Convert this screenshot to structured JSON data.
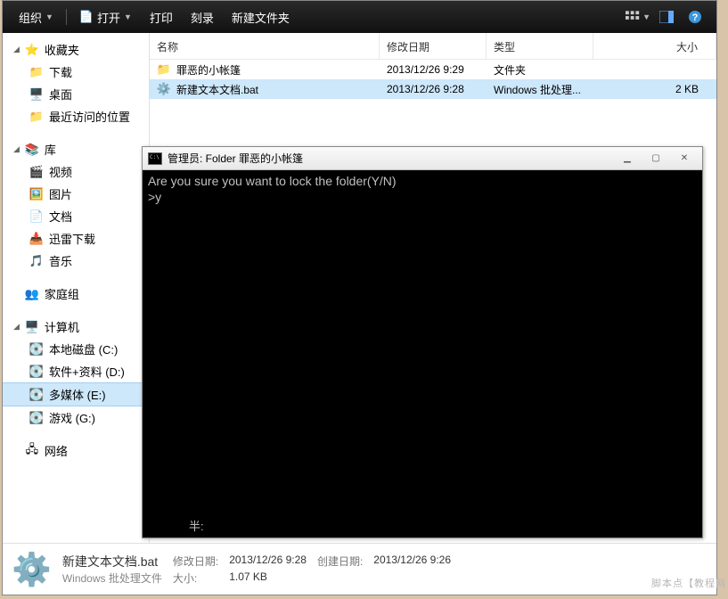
{
  "toolbar": {
    "org": "组织",
    "open": "打开",
    "print": "打印",
    "burn": "刻录",
    "newfolder": "新建文件夹"
  },
  "side": {
    "fav": {
      "hdr": "收藏夹",
      "items": [
        "下载",
        "桌面",
        "最近访问的位置"
      ]
    },
    "lib": {
      "hdr": "库",
      "items": [
        "视频",
        "图片",
        "文档",
        "迅雷下载",
        "音乐"
      ]
    },
    "home": {
      "hdr": "家庭组"
    },
    "comp": {
      "hdr": "计算机",
      "items": [
        "本地磁盘 (C:)",
        "软件+资料 (D:)",
        "多媒体 (E:)",
        "游戏 (G:)"
      ]
    },
    "net": {
      "hdr": "网络"
    }
  },
  "cols": {
    "name": "名称",
    "date": "修改日期",
    "type": "类型",
    "size": "大小"
  },
  "rows": [
    {
      "name": "罪恶的小帐篷",
      "date": "2013/12/26 9:29",
      "type": "文件夹",
      "size": ""
    },
    {
      "name": "新建文本文档.bat",
      "date": "2013/12/26 9:28",
      "type": "Windows 批处理...",
      "size": "2 KB"
    }
  ],
  "detail": {
    "name": "新建文本文档.bat",
    "type": "Windows 批处理文件",
    "labels": {
      "mod": "修改日期:",
      "size": "大小:",
      "created": "创建日期:"
    },
    "mod": "2013/12/26 9:28",
    "size": "1.07 KB",
    "created": "2013/12/26 9:26"
  },
  "cmd": {
    "title": "管理员: Folder 罪恶的小帐篷",
    "line1": "Are you sure you want to lock the folder(Y/N)",
    "line2": ">y",
    "ime": "半:"
  },
  "watermark": "脚本点【教程网"
}
